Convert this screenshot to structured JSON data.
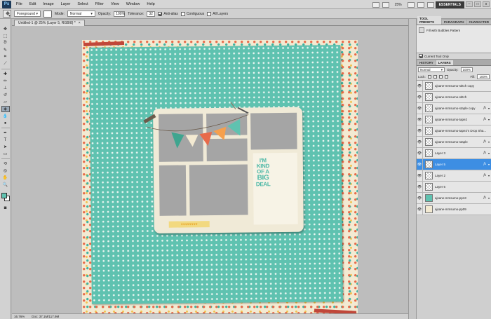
{
  "app": {
    "logo": "Ps"
  },
  "menu": [
    "File",
    "Edit",
    "Image",
    "Layer",
    "Select",
    "Filter",
    "View",
    "Window",
    "Help"
  ],
  "menubar": {
    "zoom": "25%",
    "workspace": "ESSENTIALS",
    "minimize": "–",
    "maximize": "□",
    "close": "x"
  },
  "options": {
    "fill_source": "Foreground",
    "mode_label": "Mode:",
    "mode_value": "Normal",
    "opacity_label": "Opacity:",
    "opacity_value": "100%",
    "tolerance_label": "Tolerance:",
    "tolerance_value": "32",
    "antialias_label": "Anti-alias",
    "contiguous_label": "Contiguous",
    "all_layers_label": "All Layers",
    "antialias": true,
    "contiguous": false,
    "all_layers": false
  },
  "document": {
    "tab_title": "Untitled-1 @ 25% (Layer 5, RGB/8) *",
    "close": "×",
    "quote_lines": [
      "I'M",
      "KIND",
      "OF A",
      "BIG",
      "DEAL"
    ],
    "stars": "♥♥♥♥♥♥♥♥"
  },
  "status": {
    "zoom": "16.76%",
    "doc_size": "Doc: 37.1M/117.9M"
  },
  "tool_presets": {
    "tabs": [
      "TOOL PRESETS",
      "PARAGRAPH",
      "CHARACTER"
    ],
    "item": "Fill with Bubbles Pattern",
    "footer": "Current Tool Only"
  },
  "layers_panel": {
    "tabs": [
      "HISTORY",
      "LAYERS"
    ],
    "blend_mode": "Normal",
    "opacity_label": "Opacity:",
    "opacity": "100%",
    "fill_label": "Fill:",
    "fill": "100%",
    "lock_label": "Lock:",
    "fx_label": "fx",
    "layers": [
      {
        "name": "ajsane-mmsumo-stitch copy",
        "fx": false,
        "thumb": "checker",
        "selected": false
      },
      {
        "name": "ajsane-mmsumo-stitch",
        "fx": false,
        "thumb": "checker",
        "selected": false
      },
      {
        "name": "ajsane-mmsumo-staple copy",
        "fx": true,
        "thumb": "checker",
        "selected": false
      },
      {
        "name": "ajsane-mmsumo-tape2",
        "fx": true,
        "thumb": "checker",
        "selected": false
      },
      {
        "name": "ajsane-mmsumo-tape2's Drop Sha...",
        "fx": false,
        "thumb": "checker",
        "selected": false
      },
      {
        "name": "ajsane-mmsumo-staple",
        "fx": true,
        "thumb": "checker",
        "selected": false
      },
      {
        "name": "Layer 3",
        "fx": true,
        "thumb": "checker",
        "selected": false
      },
      {
        "name": "Layer 5",
        "fx": true,
        "thumb": "checker",
        "selected": true
      },
      {
        "name": "Layer 2",
        "fx": true,
        "thumb": "checker",
        "selected": false
      },
      {
        "name": "Layer 6",
        "fx": false,
        "thumb": "checker",
        "selected": false
      },
      {
        "name": "ajsane-mmsumo-pp13",
        "fx": true,
        "thumb": "teal",
        "selected": false
      },
      {
        "name": "ajsane-mmsumo-pp09",
        "fx": false,
        "thumb": "cream",
        "selected": false
      }
    ]
  },
  "colors": {
    "foreground": "#5fc2b0",
    "background": "#ffffff",
    "selection": "#3d8ee3"
  }
}
